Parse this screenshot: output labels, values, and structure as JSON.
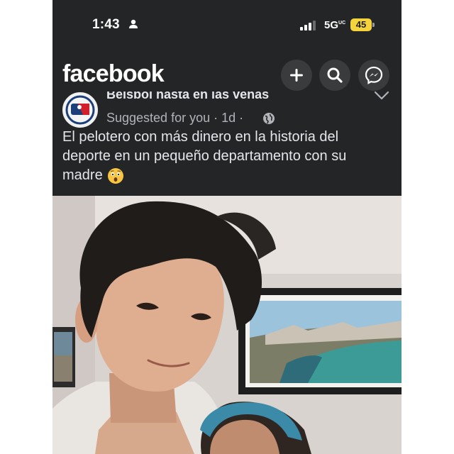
{
  "status_bar": {
    "time": "1:43",
    "network": "5G",
    "network_superscript": "UC",
    "battery": "45",
    "icons": [
      "person-icon",
      "signal-bars-icon",
      "battery-icon"
    ],
    "battery_color": "#f5d33d"
  },
  "header": {
    "logo": "facebook",
    "buttons": [
      {
        "name": "add",
        "icon": "plus-icon"
      },
      {
        "name": "search",
        "icon": "search-icon"
      },
      {
        "name": "messenger",
        "icon": "messenger-icon"
      }
    ]
  },
  "post": {
    "page_name": "Beisbol hasta en las venas",
    "meta": "Suggested for you · 1d ·",
    "audience_icon": "globe-icon",
    "text": "El pelotero con más dinero en la historia del deporte en un pequeño departamento con su madre",
    "emoji": "astonished-face-emoji",
    "image": "photo-of-man-selfie-with-woman-in-apartment"
  },
  "colors": {
    "background": "#242526",
    "button_bg": "#3a3b3c",
    "text_primary": "#e4e6eb",
    "text_secondary": "#b0b3b8"
  }
}
